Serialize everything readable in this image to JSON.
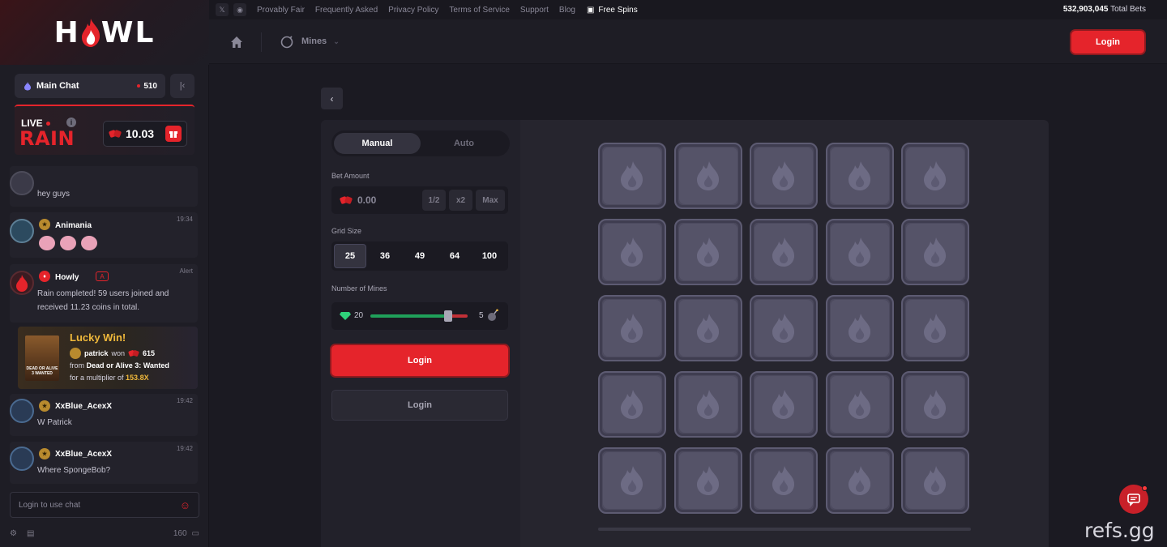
{
  "brand": {
    "logo_left": "H",
    "logo_right": "WL"
  },
  "chat": {
    "tab_label": "Main Chat",
    "online_count": "510",
    "rain": {
      "live_label": "LIVE",
      "rain_label": "RAIN",
      "amount": "10.03"
    },
    "messages": [
      {
        "user": "",
        "time": "",
        "text": "hey guys"
      },
      {
        "user": "Animania",
        "time": "19:34",
        "text": ""
      },
      {
        "user": "Howly",
        "badge": "A",
        "time": "Alert",
        "text": "Rain completed! 59 users joined and received 11.23 coins in total."
      },
      {
        "user": "XxBlue_AcexX",
        "time": "19:42",
        "text": "W Patrick"
      },
      {
        "user": "XxBlue_AcexX",
        "time": "19:42",
        "text": "Where SpongeBob?"
      }
    ],
    "lucky_win": {
      "title": "Lucky Win!",
      "user": "patrick",
      "won_label": "won",
      "amount": "615",
      "from_label": "from",
      "game": "Dead or Alive 3: Wanted",
      "multiplier_label": "for a multiplier of",
      "multiplier": "153.8X",
      "poster_text": "DEAD OR ALIVE 3 WANTED"
    },
    "input_placeholder": "Login to use chat",
    "footer_count": "160"
  },
  "topbar": {
    "links": [
      "Provably Fair",
      "Frequently Asked",
      "Privacy Policy",
      "Terms of Service",
      "Support",
      "Blog"
    ],
    "free_spins": "Free Spins",
    "total_bets_value": "532,903,045",
    "total_bets_label": "Total Bets"
  },
  "navbar": {
    "game": "Mines",
    "login": "Login"
  },
  "panel": {
    "mode_manual": "Manual",
    "mode_auto": "Auto",
    "bet_label": "Bet Amount",
    "bet_value": "0.00",
    "half": "1/2",
    "double": "x2",
    "max": "Max",
    "grid_label": "Grid Size",
    "grid_options": [
      "25",
      "36",
      "49",
      "64",
      "100"
    ],
    "grid_selected": "25",
    "mines_label": "Number of Mines",
    "gems": "20",
    "mines": "5",
    "mines_fraction": 0.8,
    "primary_button": "Login",
    "secondary_button": "Login"
  },
  "board": {
    "rows": 5,
    "cols": 5,
    "tile_icon": "flame-icon"
  },
  "colors": {
    "accent": "#e5242b",
    "gold": "#f0b93b",
    "tile": "#4c4a5e",
    "gem": "#20a05a"
  },
  "watermark": "refs.gg"
}
